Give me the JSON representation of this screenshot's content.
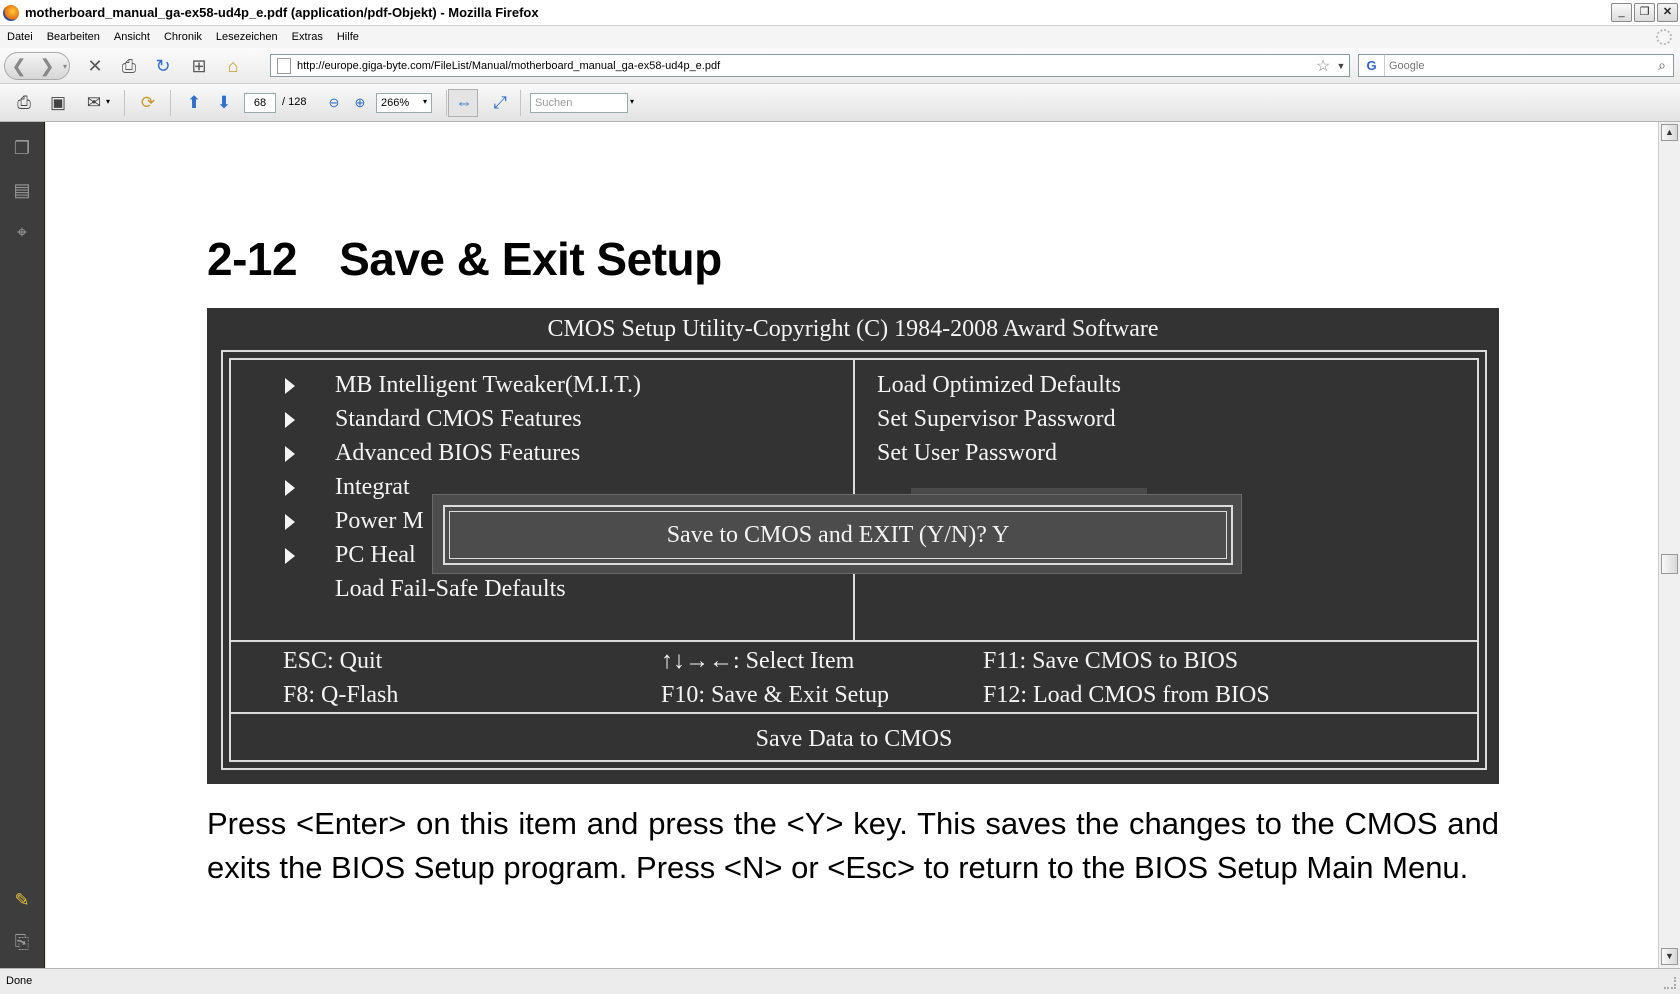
{
  "window": {
    "title": "motherboard_manual_ga-ex58-ud4p_e.pdf (application/pdf-Objekt) - Mozilla Firefox",
    "controls": {
      "minimize": "_",
      "restore": "❐",
      "close": "✕"
    }
  },
  "menubar": {
    "items": [
      "Datei",
      "Bearbeiten",
      "Ansicht",
      "Chronik",
      "Lesezeichen",
      "Extras",
      "Hilfe"
    ]
  },
  "navbar": {
    "url": "http://europe.giga-byte.com/FileList/Manual/motherboard_manual_ga-ex58-ud4p_e.pdf",
    "search_engine": "G",
    "search_placeholder": "Google"
  },
  "pdf_toolbar": {
    "page_current": "68",
    "page_total": "/ 128",
    "zoom": "266%",
    "find_placeholder": "Suchen"
  },
  "document": {
    "heading_number": "2-12",
    "heading_title": "Save & Exit Setup",
    "bios": {
      "title": "CMOS Setup Utility-Copyright (C) 1984-2008 Award Software",
      "left_menu": [
        "MB Intelligent Tweaker(M.I.T.)",
        "Standard CMOS Features",
        "Advanced BIOS Features",
        "Integrat",
        "Power M",
        "PC Heal",
        "Load Fail-Safe Defaults"
      ],
      "right_menu": [
        "Load Optimized Defaults",
        "Set Supervisor Password",
        "Set User Password"
      ],
      "keys": {
        "esc": "ESC: Quit",
        "select": "↑↓→←: Select Item",
        "f11": "F11: Save CMOS to BIOS",
        "f8": "F8: Q-Flash",
        "f10": "F10: Save & Exit Setup",
        "f12": "F12: Load CMOS from BIOS"
      },
      "status": "Save Data to CMOS",
      "dialog": "Save to CMOS and EXIT (Y/N)? Y"
    },
    "body_text": "Press <Enter> on this item and press the <Y> key. This saves the changes to the CMOS and exits the BIOS Setup program. Press <N> or <Esc> to return to the BIOS Setup Main Menu."
  },
  "statusbar": {
    "text": "Done"
  }
}
